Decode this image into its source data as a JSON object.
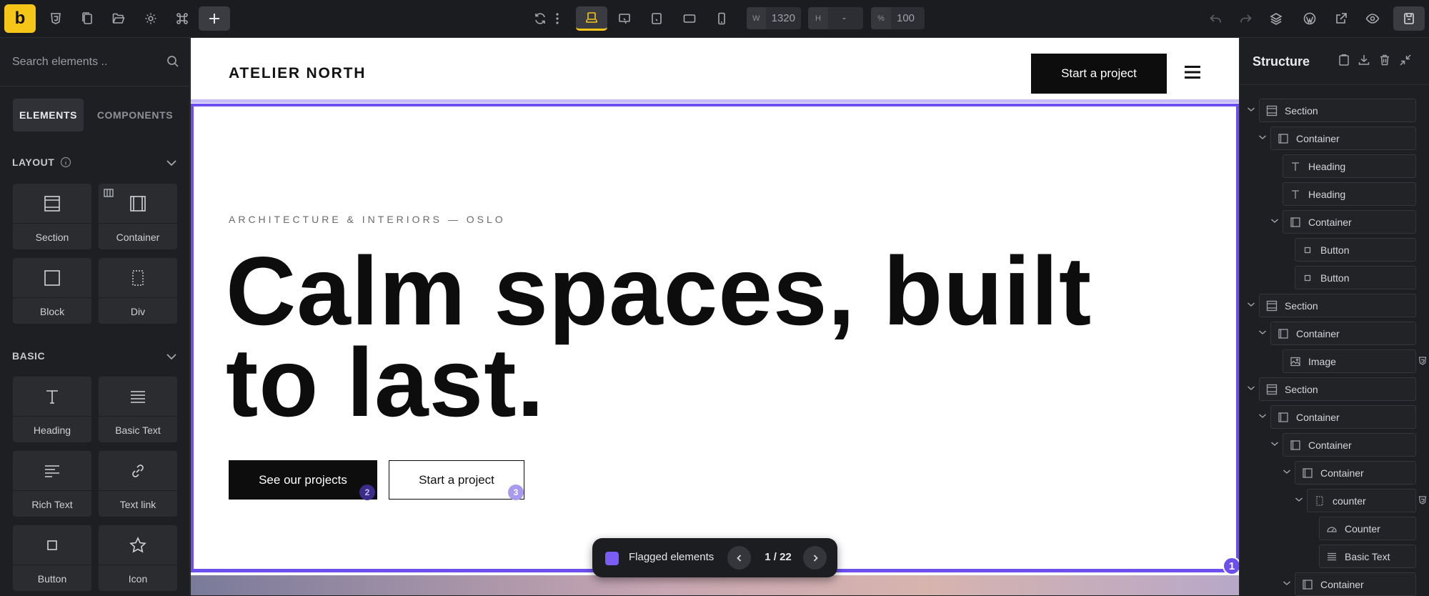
{
  "topbar": {
    "logo": "b",
    "width_label": "W",
    "width_value": "1320",
    "height_label": "H",
    "height_value": "-",
    "zoom_label": "%",
    "zoom_value": "100"
  },
  "left_panel": {
    "search_placeholder": "Search elements ..",
    "tabs": [
      "ELEMENTS",
      "COMPONENTS"
    ],
    "categories": {
      "layout": {
        "title": "LAYOUT",
        "items": [
          "Section",
          "Container",
          "Block",
          "Div"
        ]
      },
      "basic": {
        "title": "BASIC",
        "items": [
          "Heading",
          "Basic Text",
          "Rich Text",
          "Text link",
          "Button",
          "Icon"
        ]
      }
    }
  },
  "canvas": {
    "brand": "ATELIER NORTH",
    "header_cta": "Start a project",
    "eyebrow": "ARCHITECTURE & INTERIORS — OSLO",
    "headline": "Calm spaces, built to last.",
    "primary_button": "See our projects",
    "secondary_button": "Start a project",
    "flags": [
      "1",
      "2",
      "3"
    ]
  },
  "flagbar": {
    "label": "Flagged elements",
    "count": "1 / 22"
  },
  "structure": {
    "title": "Structure",
    "nodes": [
      "Section",
      "Container",
      "Heading",
      "Heading",
      "Container",
      "Button",
      "Button",
      "Section",
      "Container",
      "Image",
      "Section",
      "Container",
      "Container",
      "Container",
      "counter",
      "Counter",
      "Basic Text",
      "Container"
    ]
  },
  "colors": {
    "accent_yellow": "#f5c518",
    "selection_purple": "#6d4ff0",
    "panel_bg": "#1e1f22"
  }
}
